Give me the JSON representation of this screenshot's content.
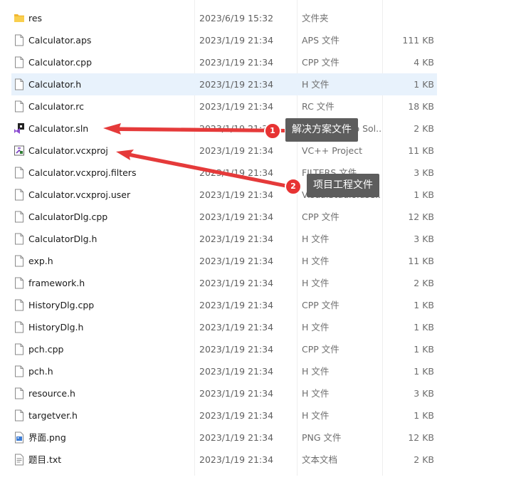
{
  "files": [
    {
      "name": "res",
      "date": "2023/6/19 15:32",
      "type": "文件夹",
      "size": "",
      "icon": "folder-icon"
    },
    {
      "name": "Calculator.aps",
      "date": "2023/1/19 21:34",
      "type": "APS 文件",
      "size": "111 KB",
      "icon": "file-icon"
    },
    {
      "name": "Calculator.cpp",
      "date": "2023/1/19 21:34",
      "type": "CPP 文件",
      "size": "4 KB",
      "icon": "file-icon"
    },
    {
      "name": "Calculator.h",
      "date": "2023/1/19 21:34",
      "type": "H 文件",
      "size": "1 KB",
      "icon": "file-icon"
    },
    {
      "name": "Calculator.rc",
      "date": "2023/1/19 21:34",
      "type": "RC 文件",
      "size": "18 KB",
      "icon": "file-icon"
    },
    {
      "name": "Calculator.sln",
      "date": "2023/1/19 21:34",
      "type": "Visual Studio Sol...",
      "size": "2 KB",
      "icon": "vs-solution-icon"
    },
    {
      "name": "Calculator.vcxproj",
      "date": "2023/1/19 21:34",
      "type": "VC++ Project",
      "size": "11 KB",
      "icon": "vcxproj-icon"
    },
    {
      "name": "Calculator.vcxproj.filters",
      "date": "2023/1/19 21:34",
      "type": "FILTERS 文件",
      "size": "3 KB",
      "icon": "file-icon"
    },
    {
      "name": "Calculator.vcxproj.user",
      "date": "2023/1/19 21:34",
      "type": "VisualStudio.use...",
      "size": "1 KB",
      "icon": "file-icon"
    },
    {
      "name": "CalculatorDlg.cpp",
      "date": "2023/1/19 21:34",
      "type": "CPP 文件",
      "size": "12 KB",
      "icon": "file-icon"
    },
    {
      "name": "CalculatorDlg.h",
      "date": "2023/1/19 21:34",
      "type": "H 文件",
      "size": "3 KB",
      "icon": "file-icon"
    },
    {
      "name": "exp.h",
      "date": "2023/1/19 21:34",
      "type": "H 文件",
      "size": "11 KB",
      "icon": "file-icon"
    },
    {
      "name": "framework.h",
      "date": "2023/1/19 21:34",
      "type": "H 文件",
      "size": "2 KB",
      "icon": "file-icon"
    },
    {
      "name": "HistoryDlg.cpp",
      "date": "2023/1/19 21:34",
      "type": "CPP 文件",
      "size": "1 KB",
      "icon": "file-icon"
    },
    {
      "name": "HistoryDlg.h",
      "date": "2023/1/19 21:34",
      "type": "H 文件",
      "size": "1 KB",
      "icon": "file-icon"
    },
    {
      "name": "pch.cpp",
      "date": "2023/1/19 21:34",
      "type": "CPP 文件",
      "size": "1 KB",
      "icon": "file-icon"
    },
    {
      "name": "pch.h",
      "date": "2023/1/19 21:34",
      "type": "H 文件",
      "size": "1 KB",
      "icon": "file-icon"
    },
    {
      "name": "resource.h",
      "date": "2023/1/19 21:34",
      "type": "H 文件",
      "size": "3 KB",
      "icon": "file-icon"
    },
    {
      "name": "targetver.h",
      "date": "2023/1/19 21:34",
      "type": "H 文件",
      "size": "1 KB",
      "icon": "file-icon"
    },
    {
      "name": "界面.png",
      "date": "2023/1/19 21:34",
      "type": "PNG 文件",
      "size": "12 KB",
      "icon": "image-file-icon"
    },
    {
      "name": "题目.txt",
      "date": "2023/1/19 21:34",
      "type": "文本文档",
      "size": "2 KB",
      "icon": "text-file-icon"
    }
  ],
  "selected_index": 3,
  "annotations": [
    {
      "number": "1",
      "label": "解决方案文件"
    },
    {
      "number": "2",
      "label": "项目工程文件"
    }
  ],
  "colors": {
    "arrow": "#e53a3a",
    "selection": "#e8f2fc",
    "folder": "#f7c948",
    "callout": "#5d5d5d"
  }
}
